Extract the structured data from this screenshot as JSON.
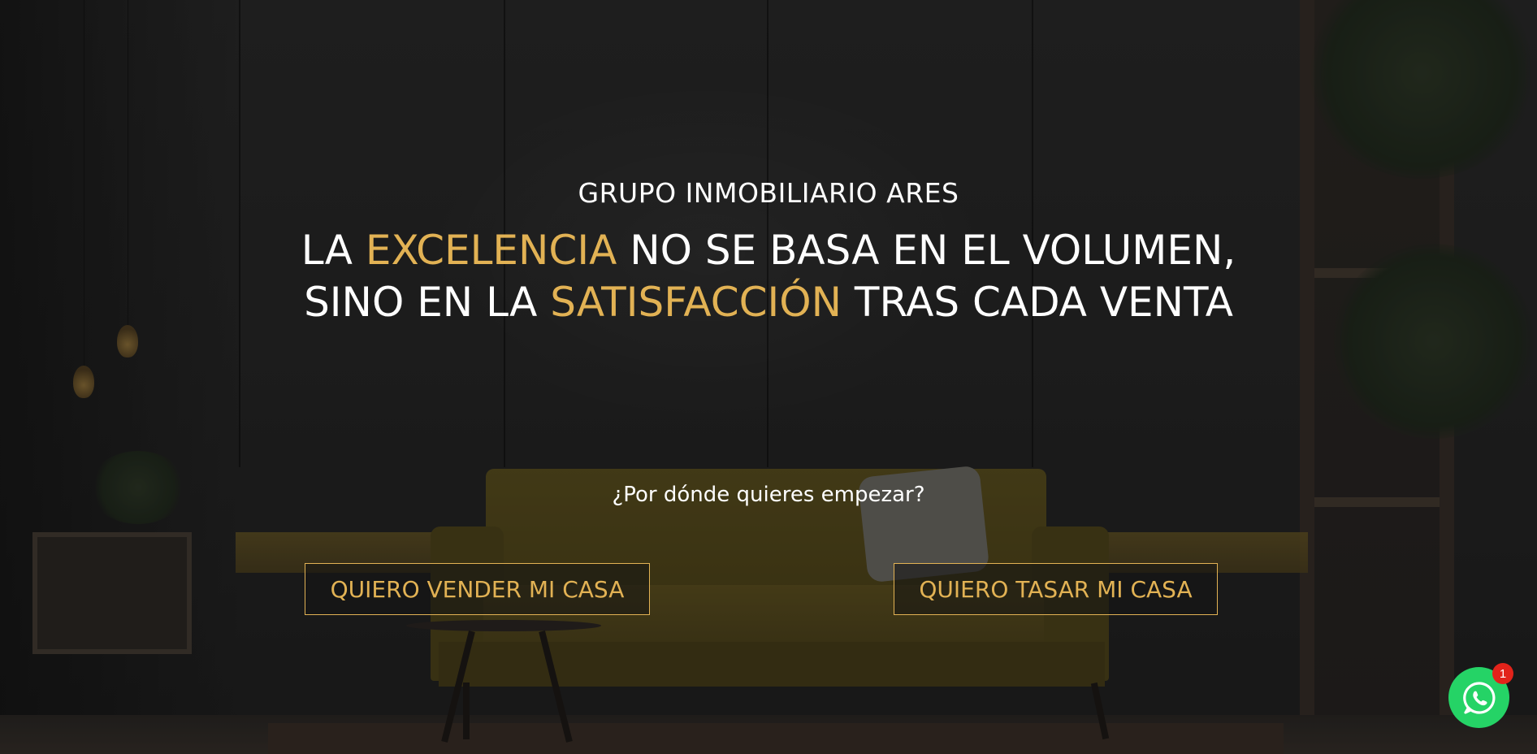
{
  "hero": {
    "brand": "GRUPO INMOBILIARIO ARES",
    "headline": {
      "line1_a": "LA ",
      "line1_gold": "EXCELENCIA",
      "line1_b": " NO SE BASA EN EL VOLUMEN,",
      "line2_a": "SINO EN LA ",
      "line2_gold": "SATISFACCIÓN",
      "line2_b": " TRAS CADA VENTA"
    },
    "question": "¿Por dónde quieres empezar?",
    "buttons": {
      "sell_label": "QUIERO VENDER MI CASA",
      "value_label": "QUIERO TASAR MI CASA"
    }
  },
  "whatsapp": {
    "icon": "whatsapp-icon",
    "badge_count": "1"
  },
  "colors": {
    "accent_gold": "#e2b254",
    "whatsapp_green": "#25d366",
    "badge_red": "#e2231a"
  }
}
